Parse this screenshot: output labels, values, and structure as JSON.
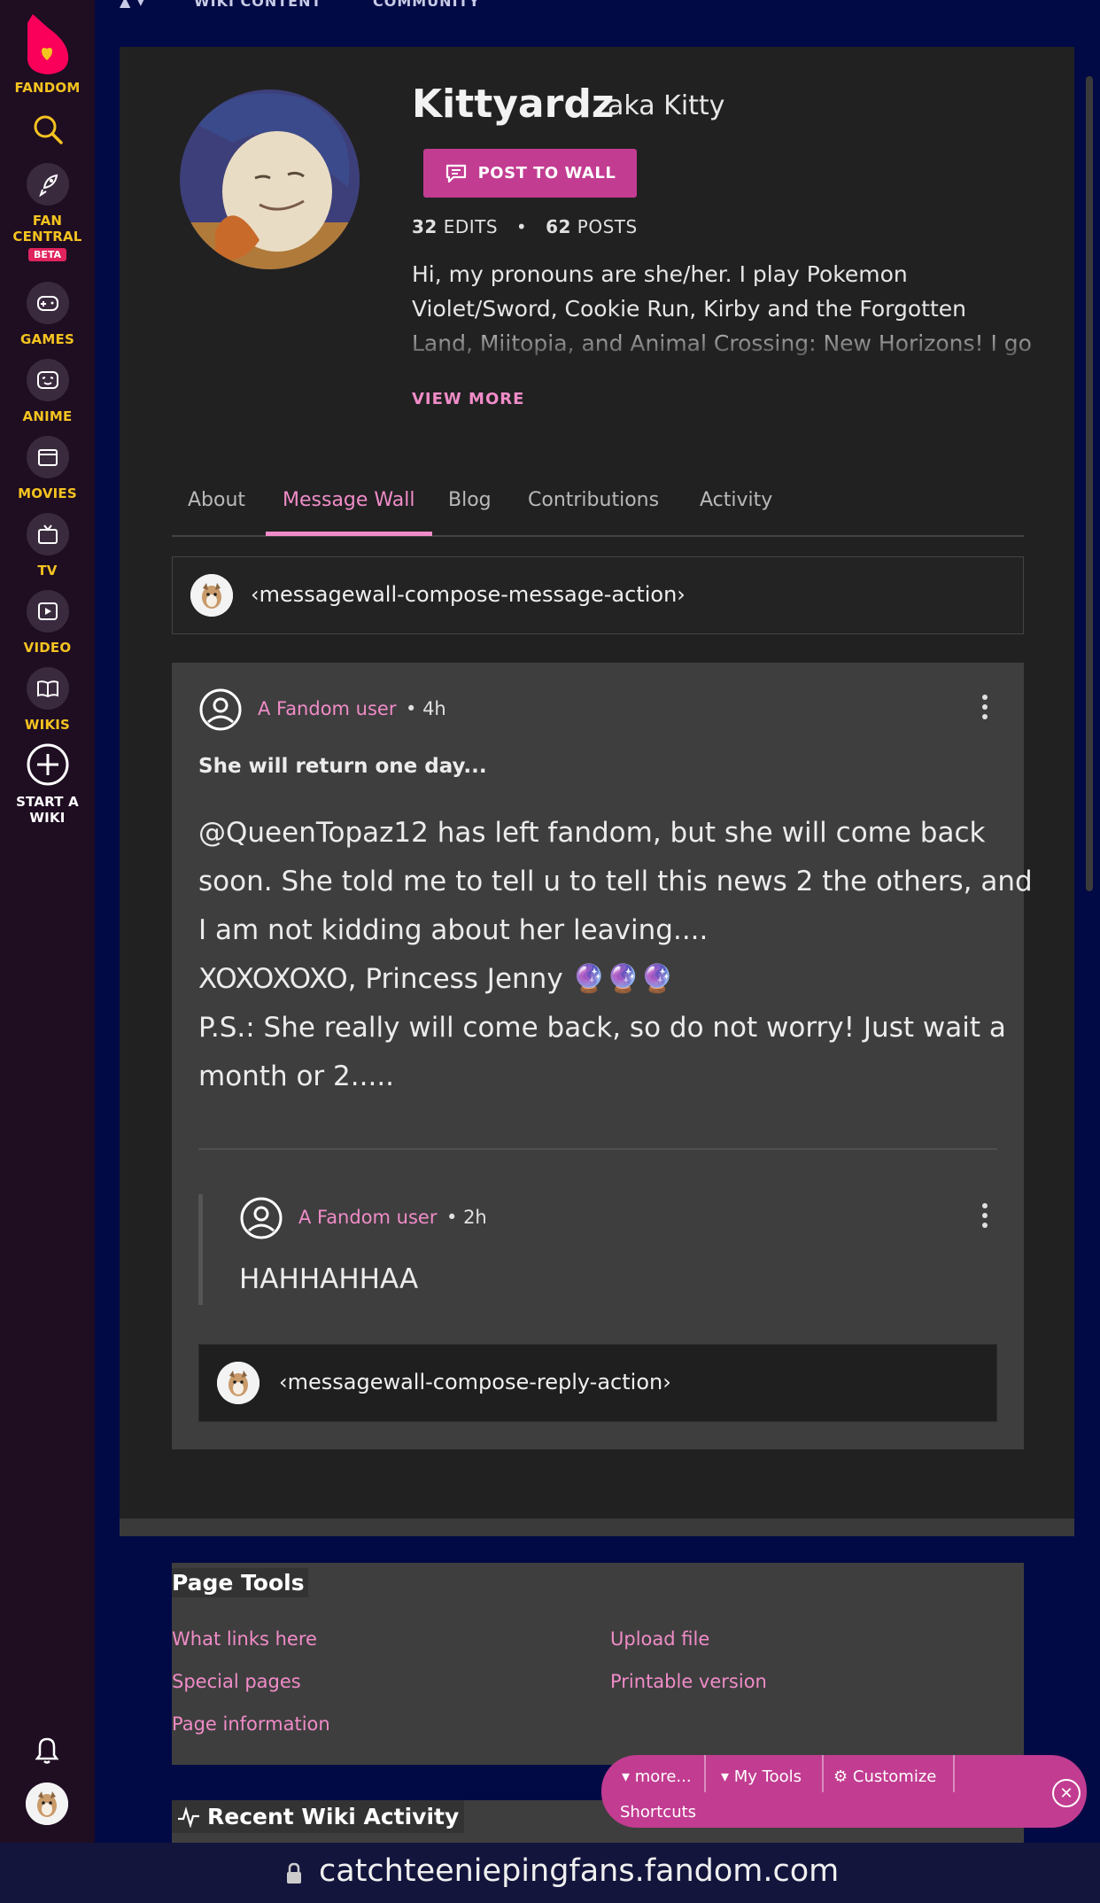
{
  "global_nav": {
    "brand": "FANDOM",
    "items": [
      {
        "label": "FAN\nCENTRAL",
        "label_line1": "FAN",
        "label_line2": "CENTRAL",
        "badge": "BETA",
        "icon": "rocket-icon"
      },
      {
        "label": "GAMES",
        "icon": "gamepad-icon"
      },
      {
        "label": "ANIME",
        "icon": "anime-face-icon"
      },
      {
        "label": "MOVIES",
        "icon": "clapperboard-icon"
      },
      {
        "label": "TV",
        "icon": "tv-icon"
      },
      {
        "label": "VIDEO",
        "icon": "play-icon"
      },
      {
        "label": "WIKIS",
        "icon": "book-icon"
      },
      {
        "label_line1": "START A",
        "label_line2": "WIKI",
        "icon": "plus-circle-icon"
      }
    ],
    "search_icon": "search-icon",
    "bell_icon": "bell-icon"
  },
  "top_nav": {
    "items": [
      "WIKI CONTENT",
      "COMMUNITY"
    ]
  },
  "profile": {
    "username": "Kittyardz",
    "aka": "aka Kitty",
    "post_button": "POST TO WALL",
    "edits_count": "32",
    "edits_label": "EDITS",
    "posts_count": "62",
    "posts_label": "POSTS",
    "bio": "Hi, my pronouns are she/her. I play Pokemon Violet/Sword, Cookie Run, Kirby and the Forgotten Land, Miitopia, and Animal Crossing: New Horizons! I go",
    "view_more": "VIEW MORE"
  },
  "tabs": [
    {
      "label": "About"
    },
    {
      "label": "Message Wall",
      "active": true
    },
    {
      "label": "Blog"
    },
    {
      "label": "Contributions"
    },
    {
      "label": "Activity"
    }
  ],
  "compose": {
    "placeholder": "‹messagewall-compose-message-action›"
  },
  "thread": {
    "author": "A Fandom user",
    "time": "4h",
    "title": "She will return one day...",
    "body_lines": [
      "@QueenTopaz12 has left fandom, but she will come back",
      "soon. She told me to tell u to tell this news 2 the others, and",
      "I am not kidding about her leaving....",
      "XOXOXOXO, Princess Jenny 🔮🔮🔮",
      "P.S.: She really will come back, so do not worry! Just wait a",
      "month or 2....."
    ],
    "reply": {
      "author": "A Fandom user",
      "time": "2h",
      "text": "HAHHAHHAA"
    },
    "reply_placeholder": "‹messagewall-compose-reply-action›"
  },
  "page_tools": {
    "title": "Page Tools",
    "links_left": [
      "What links here",
      "Special pages",
      "Page information"
    ],
    "links_right": [
      "Upload file",
      "Printable version"
    ]
  },
  "recent_activity": {
    "title": "Recent Wiki Activity"
  },
  "toolbar": {
    "more": "more...",
    "my_tools": "My Tools",
    "customize": "Customize",
    "shortcuts": "Shortcuts"
  },
  "url": "catchteeniepingfans.fandom.com",
  "colors": {
    "accent": "#c23c91",
    "link": "#f08cc8",
    "nav_label": "#f4c320",
    "brand": "#fa005a"
  }
}
